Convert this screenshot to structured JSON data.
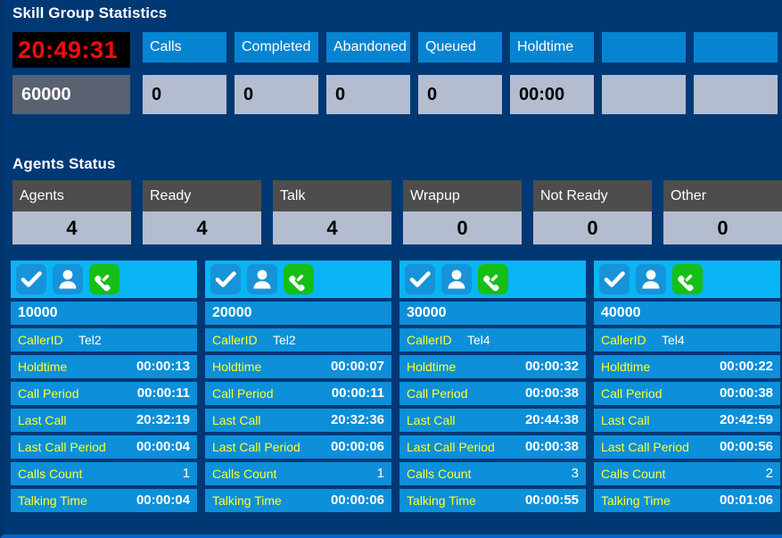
{
  "sections": {
    "skill_title": "Skill Group Statistics",
    "agents_title": "Agents Status"
  },
  "colors": {
    "background": "#003874",
    "header_blue": "#0784d1",
    "value_gray": "#b4bdd0",
    "agent_head_gray": "#4d4d4d",
    "card_blue": "#0d8fd9",
    "card_icons_blue": "#09b5f5",
    "label_yellow": "#ffff2b",
    "clock_red": "#fa0a0a",
    "phone_green": "#16bf16"
  },
  "skill_stats": {
    "clock": {
      "label": "20:49:31",
      "value": "60000"
    },
    "cells": [
      {
        "label": "Calls",
        "value": "0"
      },
      {
        "label": "Completed",
        "value": "0"
      },
      {
        "label": "Abandoned",
        "value": "0"
      },
      {
        "label": "Queued",
        "value": "0"
      },
      {
        "label": "Holdtime",
        "value": "00:00"
      },
      {
        "label": "",
        "value": ""
      },
      {
        "label": "",
        "value": ""
      }
    ]
  },
  "agents_status": [
    {
      "label": "Agents",
      "value": "4"
    },
    {
      "label": "Ready",
      "value": "4"
    },
    {
      "label": "Talk",
      "value": "4"
    },
    {
      "label": "Wrapup",
      "value": "0"
    },
    {
      "label": "Not Ready",
      "value": "0"
    },
    {
      "label": "Other",
      "value": "0"
    }
  ],
  "row_labels": {
    "callerid": "CallerID",
    "holdtime": "Holdtime",
    "call_period": "Call Period",
    "last_call": "Last Call",
    "last_call_period": "Last Call Period",
    "calls_count": "Calls Count",
    "talking_time": "Talking Time"
  },
  "agent_cards": [
    {
      "extension": "10000",
      "callerid": "Tel2",
      "holdtime": "00:00:13",
      "call_period": "00:00:11",
      "last_call": "20:32:19",
      "last_call_period": "00:00:04",
      "calls_count": "1",
      "talking_time": "00:00:04",
      "icons": [
        "check-icon",
        "user-icon",
        "phone-icon"
      ]
    },
    {
      "extension": "20000",
      "callerid": "Tel2",
      "holdtime": "00:00:07",
      "call_period": "00:00:11",
      "last_call": "20:32:36",
      "last_call_period": "00:00:06",
      "calls_count": "1",
      "talking_time": "00:00:06",
      "icons": [
        "check-icon",
        "user-icon",
        "phone-icon"
      ]
    },
    {
      "extension": "30000",
      "callerid": "Tel4",
      "holdtime": "00:00:32",
      "call_period": "00:00:38",
      "last_call": "20:44:38",
      "last_call_period": "00:00:38",
      "calls_count": "3",
      "talking_time": "00:00:55",
      "icons": [
        "check-icon",
        "user-icon",
        "phone-icon"
      ]
    },
    {
      "extension": "40000",
      "callerid": "Tel4",
      "holdtime": "00:00:22",
      "call_period": "00:00:38",
      "last_call": "20:42:59",
      "last_call_period": "00:00:56",
      "calls_count": "2",
      "talking_time": "00:01:06",
      "icons": [
        "check-icon",
        "user-icon",
        "phone-icon"
      ]
    }
  ]
}
